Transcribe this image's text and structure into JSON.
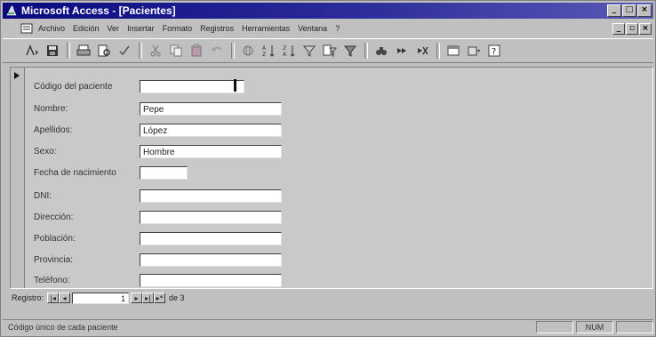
{
  "window": {
    "title": "Microsoft Access - [Pacientes]"
  },
  "menu": {
    "items": [
      "Archivo",
      "Edición",
      "Ver",
      "Insertar",
      "Formato",
      "Registros",
      "Herramientas",
      "Ventana",
      "?"
    ]
  },
  "toolbar": {
    "icons": [
      "view-icon",
      "save-icon",
      "print-icon",
      "print-preview-icon",
      "spelling-icon",
      "cut-icon",
      "copy-icon",
      "paste-icon",
      "undo-icon",
      "hyperlink-icon",
      "sort-ascending-icon",
      "sort-descending-icon",
      "filter-by-selection-icon",
      "filter-by-form-icon",
      "apply-filter-icon",
      "find-icon",
      "new-record-icon",
      "delete-record-icon",
      "database-window-icon",
      "new-object-icon",
      "help-icon"
    ]
  },
  "form": {
    "fields": [
      {
        "label": "Código del paciente",
        "value": ""
      },
      {
        "label": "Nombre:",
        "value": "Pepe"
      },
      {
        "label": "Apellidos:",
        "value": "López"
      },
      {
        "label": "Sexo:",
        "value": "Hombre"
      },
      {
        "label": "Fecha de nacimiento",
        "value": ""
      },
      {
        "label": "DNI:",
        "value": ""
      },
      {
        "label": "Dirección:",
        "value": ""
      },
      {
        "label": "Población:",
        "value": ""
      },
      {
        "label": "Provincia:",
        "value": ""
      },
      {
        "label": "Teléfono:",
        "value": ""
      }
    ]
  },
  "navigation": {
    "label": "Registro:",
    "current": "1",
    "of_label": "de 3"
  },
  "status": {
    "text": "Código único de cada paciente",
    "num": "NUM"
  },
  "colors": {
    "title_bar": "#0a0a80",
    "face": "#c0c0c0"
  }
}
